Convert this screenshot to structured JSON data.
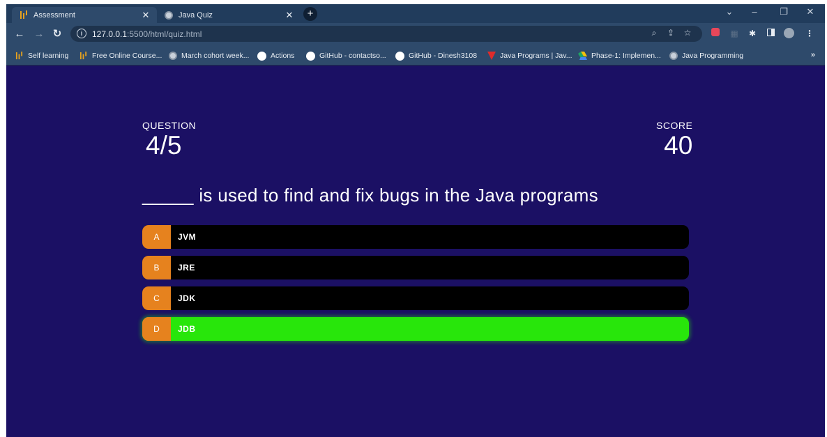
{
  "browser": {
    "tabs": [
      {
        "title": "Assessment",
        "active": true,
        "favicon": "bar-logo-icon"
      },
      {
        "title": "Java Quiz",
        "active": false,
        "favicon": "globe-icon"
      }
    ],
    "address": {
      "host": "127.0.0.1",
      "rest": ":5500/html/quiz.html"
    },
    "bookmarks": [
      {
        "label": "Self learning",
        "icon": "bar-logo-icon"
      },
      {
        "label": "Free Online Course...",
        "icon": "bar-logo-icon"
      },
      {
        "label": "March cohort week...",
        "icon": "globe-icon"
      },
      {
        "label": "Actions",
        "icon": "github-icon"
      },
      {
        "label": "GitHub - contactso...",
        "icon": "github-icon"
      },
      {
        "label": "GitHub - Dinesh3108",
        "icon": "github-icon"
      },
      {
        "label": "Java Programs | Jav...",
        "icon": "triangle-logo-icon"
      },
      {
        "label": "Phase-1: Implemen...",
        "icon": "drive-icon"
      },
      {
        "label": "Java Programming",
        "icon": "globe-icon"
      }
    ],
    "more": "»"
  },
  "quiz": {
    "question_label": "QUESTION",
    "progress": "4/5",
    "score_label": "SCORE",
    "score": "40",
    "question": "_____ is used to find and fix bugs in the Java programs",
    "choices": [
      {
        "prefix": "A",
        "text": "JVM",
        "state": "default"
      },
      {
        "prefix": "B",
        "text": "JRE",
        "state": "default"
      },
      {
        "prefix": "C",
        "text": "JDK",
        "state": "default"
      },
      {
        "prefix": "D",
        "text": "JDB",
        "state": "correct"
      }
    ]
  },
  "colors": {
    "page_bg": "#1b1064",
    "prefix_bg": "#e6821e",
    "correct": "#28e60b",
    "choice_bg": "#000000",
    "browser_chrome": "#2e4a6b"
  }
}
